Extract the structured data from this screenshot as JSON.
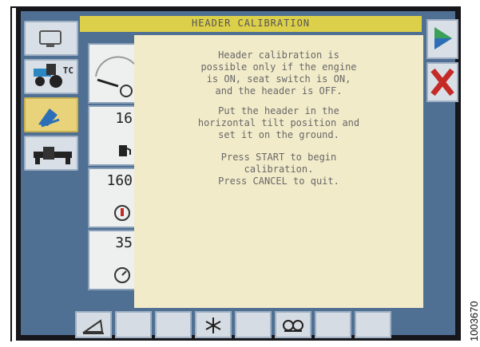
{
  "title_bar": {
    "title": "HEADER CALIBRATION"
  },
  "message": {
    "para1": [
      "Header calibration is",
      "possible only if the engine",
      "is ON, seat switch is ON,",
      "and the header is OFF."
    ],
    "para2": [
      "Put the header in the",
      "horizontal tilt position and",
      "set it on the ground."
    ],
    "para3": [
      "Press START to begin",
      "calibration.",
      "Press CANCEL to quit."
    ]
  },
  "left_nav": {
    "items": [
      {
        "name": "monitor-button",
        "icon": "monitor-icon",
        "small_text": ""
      },
      {
        "name": "tractor-button",
        "icon": "tractor-icon",
        "small_text": "TC"
      },
      {
        "name": "calibration-button",
        "icon": "header-tilt-icon",
        "small_text": "",
        "active": true
      },
      {
        "name": "header-button",
        "icon": "header-icon",
        "small_text": ""
      }
    ]
  },
  "gauges": [
    {
      "name": "speed-gauge",
      "value": "",
      "icon": "clock-gauge-icon"
    },
    {
      "name": "fuel-gauge",
      "value": "16",
      "icon": "fuel-icon"
    },
    {
      "name": "temp-gauge",
      "value": "160",
      "icon": "thermometer-icon"
    },
    {
      "name": "pressure-gauge",
      "value": "35",
      "icon": "pressure-icon"
    }
  ],
  "right_buttons": {
    "start_icon": "play-icon",
    "cancel_icon": "close-x-icon"
  },
  "bottom_bar": {
    "icons": [
      "tilt-icon",
      "",
      "",
      "star-icon",
      "",
      "binoculars-icon",
      "",
      ""
    ]
  },
  "watermark": "1003670",
  "colors": {
    "accent": "#dcd04a",
    "panel": "#4f6f93",
    "message_bg": "#f2ebc9",
    "cancel_red": "#c42b27",
    "start_green": "#3aa05a",
    "start_blue": "#2d6fb6"
  }
}
